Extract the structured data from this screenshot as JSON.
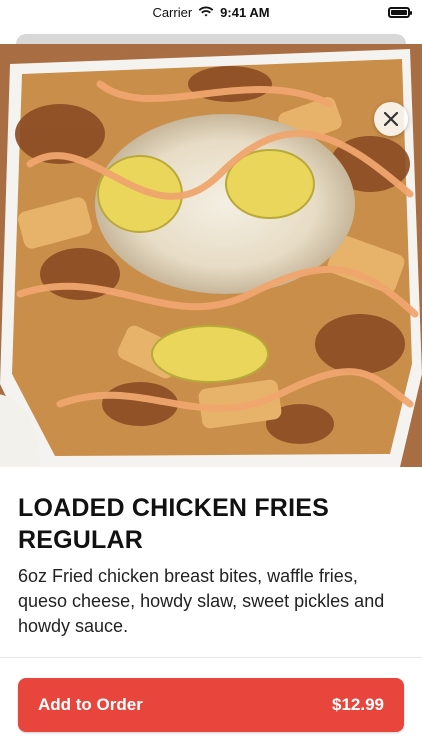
{
  "status_bar": {
    "carrier": "Carrier",
    "time": "9:41 AM"
  },
  "item": {
    "title": "LOADED CHICKEN FRIES REGULAR",
    "description": "6oz Fried chicken breast bites, waffle fries, queso cheese, howdy slaw, sweet pickles and howdy sauce.",
    "image_icon": "food-photo"
  },
  "actions": {
    "close_icon": "close-icon",
    "add_label": "Add to Order",
    "price": "$12.99"
  },
  "colors": {
    "accent": "#e8453c"
  }
}
